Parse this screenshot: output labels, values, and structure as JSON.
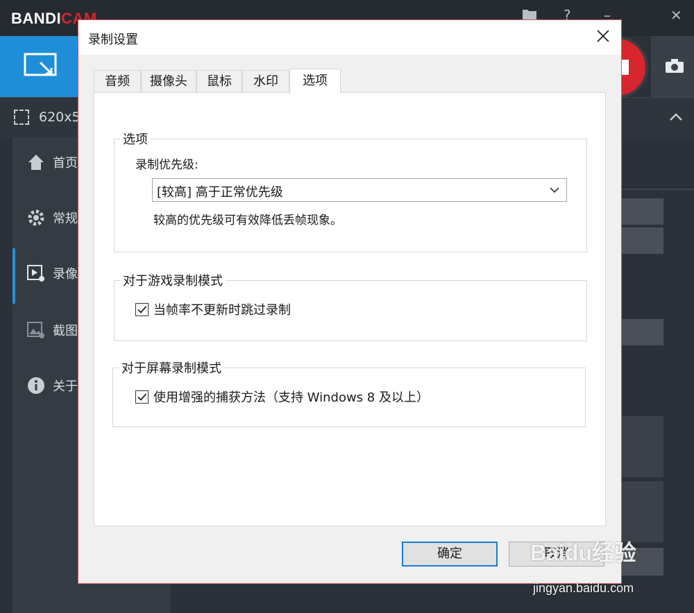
{
  "background_app": {
    "logo_prefix": "BANDI",
    "logo_suffix": "CAM",
    "size_text": "620x5",
    "nav": [
      {
        "label": "首页",
        "icon": "home-icon"
      },
      {
        "label": "常规",
        "icon": "gear-icon"
      },
      {
        "label": "录像",
        "icon": "video-settings-icon"
      },
      {
        "label": "截图",
        "icon": "image-settings-icon"
      },
      {
        "label": "关于",
        "icon": "info-icon"
      }
    ],
    "active_nav_index": 2,
    "accent_color": "#1e8fd6",
    "record_color": "#d7262d"
  },
  "dialog": {
    "title": "录制设置",
    "close_icon": "close-icon",
    "tabs": [
      "音频",
      "摄像头",
      "鼠标",
      "水印",
      "选项"
    ],
    "active_tab": "选项",
    "options_group": {
      "legend": "选项",
      "priority_label": "录制优先级:",
      "priority_value": "[较高] 高于正常优先级",
      "priority_hint": "较高的优先级可有效降低丢帧现象。"
    },
    "game_group": {
      "legend": "对于游戏录制模式",
      "checkbox_label": "当帧率不更新时跳过录制",
      "checked": true
    },
    "screen_group": {
      "legend": "对于屏幕录制模式",
      "checkbox_label": "使用增强的捕获方法（支持 Windows 8 及以上）",
      "checked": true
    },
    "ok_label": "确定",
    "cancel_label": "取消",
    "border_color": "#d9575c",
    "primary_button_border": "#1a7bd2"
  },
  "watermark": {
    "brand": "Baidu经验",
    "url": "jingyan.baidu.com"
  }
}
